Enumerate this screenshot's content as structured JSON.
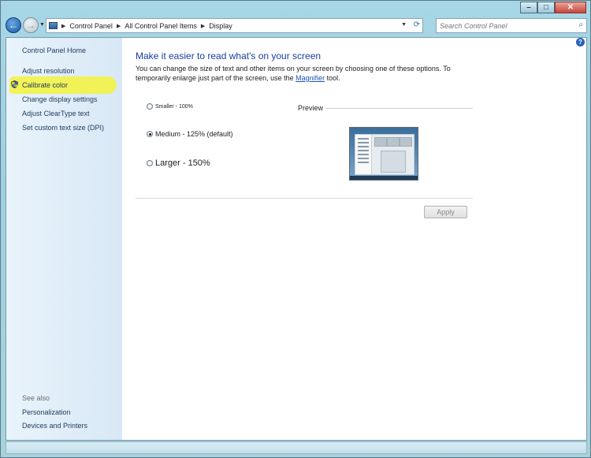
{
  "window": {
    "minimize_label": "–",
    "maximize_label": "□",
    "close_label": "✕"
  },
  "address_bar": {
    "breadcrumbs": [
      "Control Panel",
      "All Control Panel Items",
      "Display"
    ],
    "search_placeholder": "Search Control Panel"
  },
  "sidebar": {
    "home": "Control Panel Home",
    "tasks": [
      "Adjust resolution",
      "Calibrate color",
      "Change display settings",
      "Adjust ClearType text",
      "Set custom text size (DPI)"
    ],
    "see_also_heading": "See also",
    "see_also": [
      "Personalization",
      "Devices and Printers"
    ]
  },
  "main": {
    "title": "Make it easier to read what's on your screen",
    "desc_before": "You can change the size of text and other items on your screen by choosing one of these options. To temporarily enlarge just part of the screen, use the ",
    "desc_link": "Magnifier",
    "desc_after": " tool.",
    "options": [
      {
        "label": "Smaller - 100%",
        "selected": false
      },
      {
        "label": "Medium - 125% (default)",
        "selected": true
      },
      {
        "label": "Larger - 150%",
        "selected": false
      }
    ],
    "preview_label": "Preview",
    "apply_label": "Apply",
    "help_label": "?"
  },
  "colors": {
    "link": "#1e395b",
    "title": "#1a3e9c",
    "highlight": "#f1f24e"
  }
}
